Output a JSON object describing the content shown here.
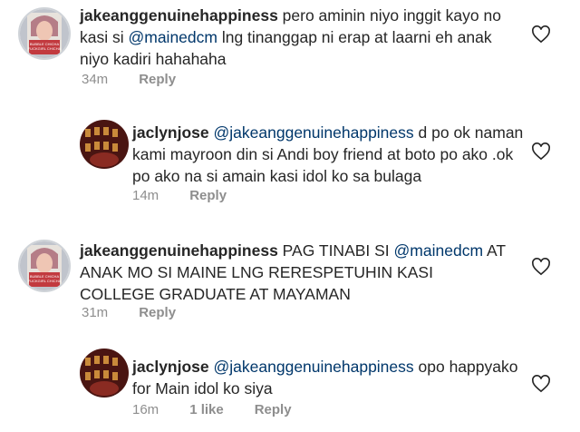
{
  "comments": [
    {
      "username": "jakeanggenuinehappiness",
      "avatar_text": [
        "BUBBLE CHICHA",
        "FUCKGIRL CHICHA"
      ],
      "text_before": " pero aminin niyo inggit kayo no kasi si ",
      "mention": "@mainedcm",
      "text_after": " lng tinanggap ni erap at laarni eh anak niyo kadiri hahahaha",
      "time": "34m",
      "reply_label": "Reply",
      "like_icon": "heart-outline-icon"
    },
    {
      "username": "jaclynjose",
      "text_before": " ",
      "mention": "@jakeanggenuinehappiness",
      "text_after": " d po ok naman kami mayroon din si Andi boy friend at boto po ako .ok po ako na si amain kasi idol ko sa bulaga",
      "time": "14m",
      "reply_label": "Reply",
      "like_icon": "heart-outline-icon"
    },
    {
      "username": "jakeanggenuinehappiness",
      "avatar_text": [
        "BUBBLE CHICHA",
        "FUCKGIRL CHICHA"
      ],
      "text_before": " PAG TINABI SI ",
      "mention": "@mainedcm",
      "text_after": " AT ANAK MO SI MAINE LNG RERESPETUHIN KASI COLLEGE GRADUATE AT MAYAMAN",
      "time": "31m",
      "reply_label": "Reply",
      "like_icon": "heart-outline-icon"
    },
    {
      "username": "jaclynjose",
      "text_before": " ",
      "mention": "@jakeanggenuinehappiness",
      "text_after": " opo happyako for Main idol ko siya",
      "time": "16m",
      "likes": "1 like",
      "reply_label": "Reply",
      "like_icon": "heart-outline-icon"
    }
  ],
  "colors": {
    "text": "#262626",
    "meta": "#8e8e8e",
    "mention": "#00376b"
  }
}
